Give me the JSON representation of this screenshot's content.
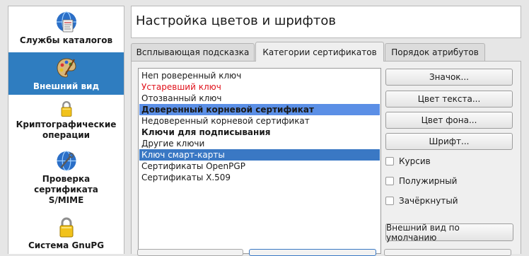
{
  "sidebar": {
    "items": [
      {
        "label": "Службы каталогов",
        "icon": "directory-services-icon",
        "selected": false
      },
      {
        "label": "Внешний вид",
        "icon": "palette-icon",
        "selected": true
      },
      {
        "label": "Криптографические операции",
        "icon": "lock-icon",
        "selected": false
      },
      {
        "label": "Проверка сертификата S/MIME",
        "icon": "certificate-check-icon",
        "selected": false
      },
      {
        "label": "Система GnuPG",
        "icon": "lock-icon",
        "selected": false
      }
    ]
  },
  "header": {
    "title": "Настройка цветов и шрифтов"
  },
  "tabs": [
    {
      "label": "Всплывающая подсказка",
      "active": false
    },
    {
      "label": "Категории сертификатов",
      "active": true
    },
    {
      "label": "Порядок атрибутов",
      "active": false
    }
  ],
  "categories": [
    {
      "label": "Неп роверенный ключ",
      "style": "normal"
    },
    {
      "label": "Устаревший ключ",
      "style": "red"
    },
    {
      "label": "Отозванный ключ",
      "style": "normal"
    },
    {
      "label": "Доверенный корневой сертификат",
      "style": "bold-highlight"
    },
    {
      "label": "Недоверенный корневой сертификат",
      "style": "normal"
    },
    {
      "label": "Ключи для подписывания",
      "style": "bold"
    },
    {
      "label": "Другие ключи",
      "style": "normal"
    },
    {
      "label": "Ключ смарт-карты",
      "style": "selected"
    },
    {
      "label": "Сертификаты OpenPGP",
      "style": "normal"
    },
    {
      "label": "Сертификаты X.509",
      "style": "normal"
    }
  ],
  "buttons": {
    "icon": "Значок...",
    "text_color": "Цвет текста...",
    "bg_color": "Цвет фона...",
    "font": "Шрифт...",
    "default_look": "Внешний вид по умолчанию"
  },
  "checkboxes": {
    "italic": "Курсив",
    "bold": "Полужирный",
    "strike": "Зачёркнутый"
  },
  "colors": {
    "accent": "#2f7dc0",
    "highlight": "#5b8fe6",
    "expired": "#e0101a"
  }
}
